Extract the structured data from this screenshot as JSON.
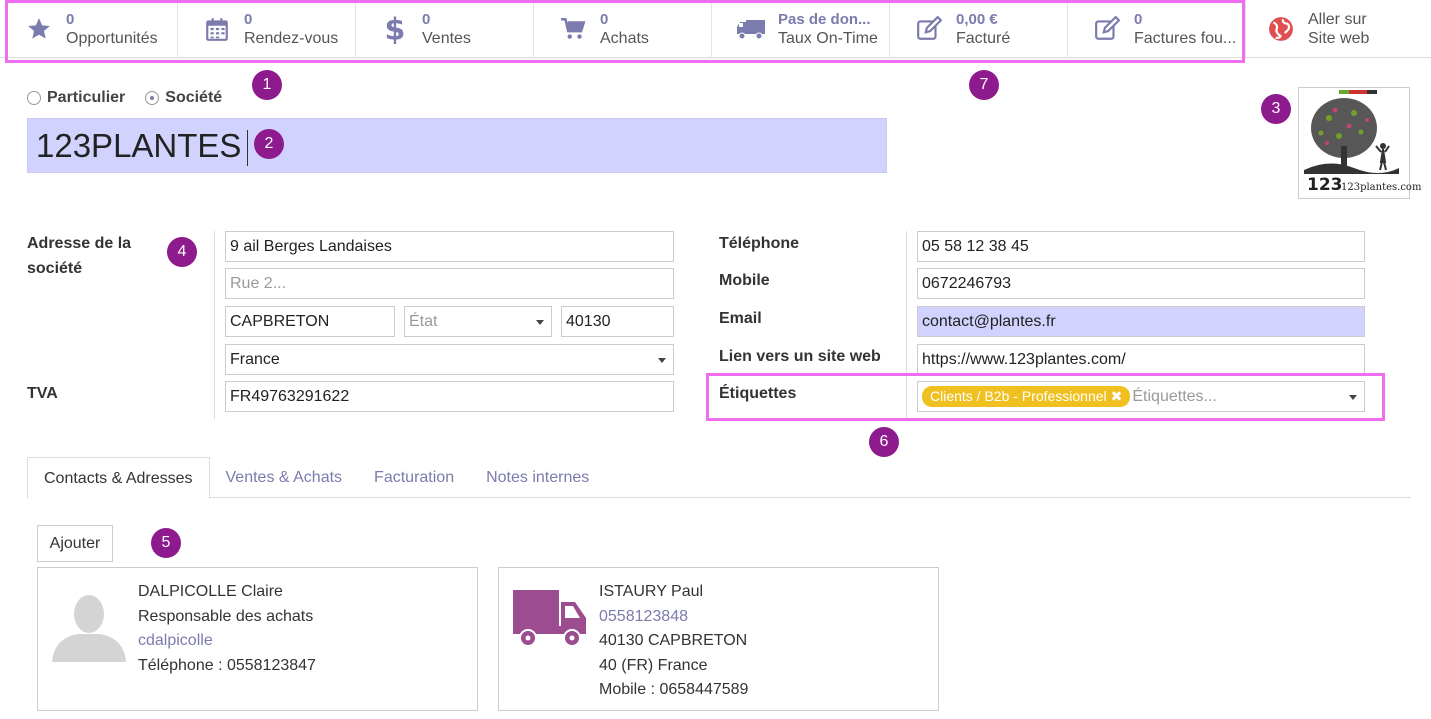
{
  "stats": [
    {
      "icon": "star-icon",
      "value": "0",
      "label": "Opportunités"
    },
    {
      "icon": "calendar-icon",
      "value": "0",
      "label": "Rendez-vous"
    },
    {
      "icon": "dollar-icon",
      "value": "0",
      "label": "Ventes"
    },
    {
      "icon": "cart-icon",
      "value": "0",
      "label": "Achats"
    },
    {
      "icon": "truck-icon",
      "value": "Pas de don...",
      "label": "Taux On-Time"
    },
    {
      "icon": "edit-icon",
      "value": "0,00 €",
      "label": "Facturé"
    },
    {
      "icon": "edit-icon",
      "value": "0",
      "label": "Factures fou..."
    }
  ],
  "website": {
    "line1": "Aller sur",
    "line2": "Site web"
  },
  "company_type": {
    "individual": "Particulier",
    "company": "Société",
    "selected": "Société"
  },
  "name": "123PLANTES",
  "logo_text": "123plantes.com",
  "badges": [
    "1",
    "2",
    "3",
    "4",
    "5",
    "6",
    "7"
  ],
  "address": {
    "label_line1": "Adresse de la",
    "label_line2": "société",
    "street": "9 ail Berges Landaises",
    "street2_placeholder": "Rue 2...",
    "city": "CAPBRETON",
    "state_placeholder": "État",
    "zip": "40130",
    "country": "France"
  },
  "vat": {
    "label": "TVA",
    "value": "FR49763291622"
  },
  "contact_fields": {
    "phone_label": "Téléphone",
    "phone": "05 58 12 38 45",
    "mobile_label": "Mobile",
    "mobile": "0672246793",
    "email_label": "Email",
    "email": "contact@plantes.fr",
    "website_label": "Lien vers un site web",
    "website": "https://www.123plantes.com/",
    "tags_label": "Étiquettes",
    "tag": "Clients / B2b - Professionnel",
    "tags_placeholder": "Étiquettes..."
  },
  "tabs": [
    "Contacts & Adresses",
    "Ventes & Achats",
    "Facturation",
    "Notes internes"
  ],
  "add_button": "Ajouter",
  "contacts": [
    {
      "name": "DALPICOLLE Claire",
      "role": "Responsable des achats",
      "login": "cdalpicolle",
      "phone": "Téléphone : 0558123847"
    },
    {
      "name": "ISTAURY Paul",
      "phone": "0558123848",
      "city": "40130 CAPBRETON",
      "country": "40 (FR) France",
      "mobile": "Mobile : 0658447589"
    }
  ],
  "colors": {
    "accent": "#7c7bad",
    "highlight": "#f06df0",
    "badge": "#8e1b8e",
    "field_highlight": "#d2d2ff",
    "tag": "#f0c020"
  }
}
